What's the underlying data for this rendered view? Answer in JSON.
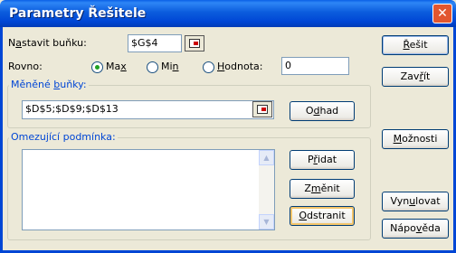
{
  "window": {
    "title": "Parametry Řešitele",
    "close_glyph": "✕"
  },
  "target_cell": {
    "label_prefix": "N",
    "label_accel": "a",
    "label_rest": "stavit buňku:",
    "value": "$G$4"
  },
  "equal_to": {
    "label": "Rovno:",
    "max": {
      "pre": "Ma",
      "accel": "x",
      "post": "",
      "selected": true
    },
    "min": {
      "pre": "Mi",
      "accel": "n",
      "post": "",
      "selected": false
    },
    "value": {
      "pre": "",
      "accel": "H",
      "post": "odnota:",
      "selected": false,
      "input": "0"
    }
  },
  "changing_cells": {
    "group_pre": "Měněné ",
    "group_accel": "b",
    "group_post": "uňky:",
    "value": "$D$5;$D$9;$D$13",
    "guess_button": {
      "pre": "O",
      "accel": "d",
      "post": "had"
    }
  },
  "constraints": {
    "group_pre": "Omezu",
    "group_accel": "j",
    "group_post": "ící podmínka:",
    "items": [],
    "add_button": {
      "pre": "P",
      "accel": "ř",
      "post": "idat"
    },
    "change_button": {
      "pre": "Z",
      "accel": "m",
      "post": "ěnit"
    },
    "delete_button": {
      "pre": "",
      "accel": "O",
      "post": "dstranit"
    }
  },
  "right_buttons": {
    "solve": {
      "pre": "",
      "accel": "Ř",
      "post": "ešit"
    },
    "close": {
      "pre": "Zav",
      "accel": "ř",
      "post": "ít"
    },
    "options": {
      "pre": "",
      "accel": "M",
      "post": "ožnosti"
    },
    "reset": {
      "pre": "Vyn",
      "accel": "u",
      "post": "lovat"
    },
    "help": {
      "pre": "Nápo",
      "accel": "v",
      "post": "ěda"
    }
  }
}
